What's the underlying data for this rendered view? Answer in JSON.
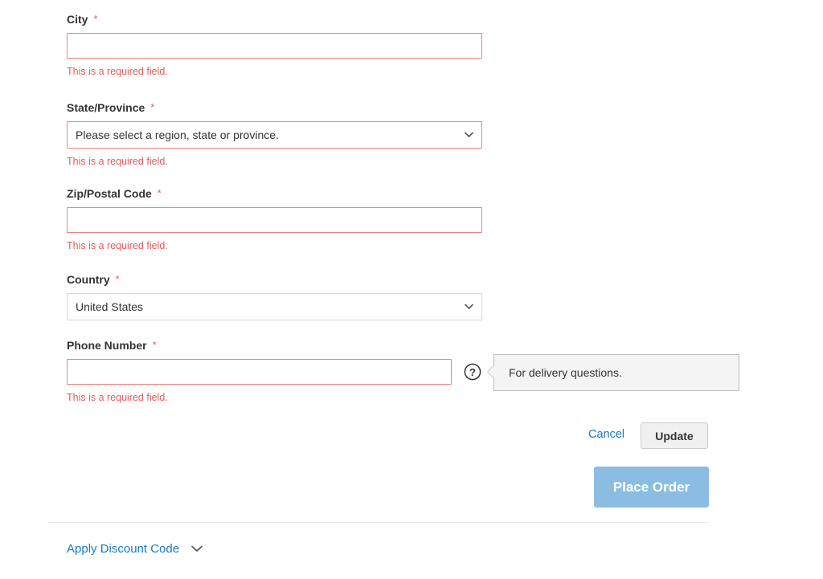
{
  "colors": {
    "error": "#e55c5c",
    "error_border": "#ed8380",
    "link": "#1979c3",
    "place_order_bg": "#8bbde2",
    "label": "#333333",
    "neutral_border": "#d6d6d6",
    "tooltip_bg": "#f4f4f4"
  },
  "form": {
    "required_marker": "*",
    "error_text": "This is a required field.",
    "fields": [
      {
        "id": "city",
        "label": "City",
        "required": true,
        "type": "text",
        "value": "",
        "error": "This is a required field."
      },
      {
        "id": "state-province",
        "label": "State/Province",
        "required": true,
        "type": "select",
        "value": "Please select a region, state or province.",
        "error": "This is a required field."
      },
      {
        "id": "zip-postal-code",
        "label": "Zip/Postal Code",
        "required": true,
        "type": "text",
        "value": "",
        "error": "This is a required field."
      },
      {
        "id": "country",
        "label": "Country",
        "required": true,
        "type": "select",
        "value": "United States",
        "error": ""
      },
      {
        "id": "phone-number",
        "label": "Phone Number",
        "required": true,
        "type": "text",
        "value": "",
        "error": "This is a required field."
      }
    ]
  },
  "tooltip": {
    "icon": "help-circle-icon",
    "text": "For delivery questions."
  },
  "actions": {
    "cancel_label": "Cancel",
    "update_label": "Update",
    "place_order_label": "Place Order"
  },
  "discount": {
    "label": "Apply Discount Code",
    "icon": "chevron-down-icon"
  }
}
